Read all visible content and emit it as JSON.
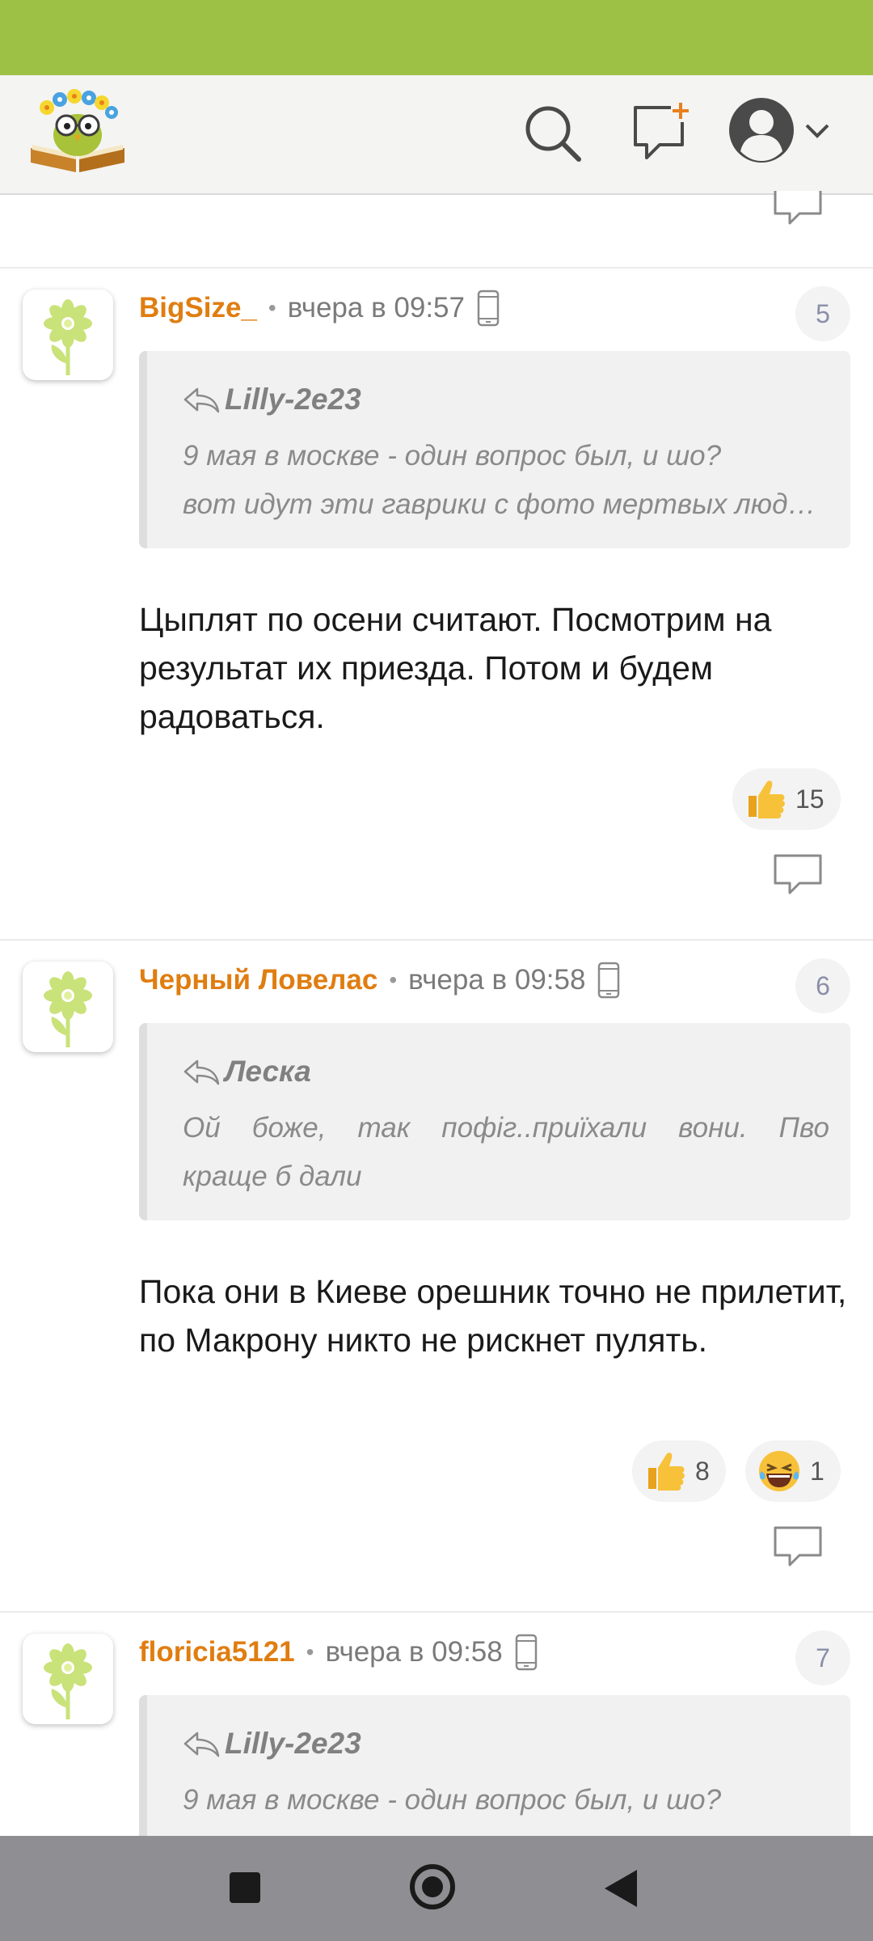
{
  "colors": {
    "status_bar": "#9cc145",
    "author": "#e07d10",
    "nav_bar": "#8f8f93"
  },
  "header": {
    "logo": "owl-book-logo",
    "icons": [
      "search-icon",
      "new-message-icon",
      "profile-icon",
      "chevron-down-icon"
    ]
  },
  "comments": [
    {
      "author": "BigSize_",
      "time": "вчера в 09:57",
      "number": "5",
      "quote_author": "Lilly-2e23",
      "quote_lines": [
        "9 мая в москве - один вопрос был, и шо?",
        "вот идут эти гаврики с фото мертвых люде…"
      ],
      "text": "Цыплят по осени считают. Посмотрим на результат их приезда. Потом и будем радоваться.",
      "reactions": [
        {
          "icon": "thumbs-up-icon",
          "count": "15"
        }
      ]
    },
    {
      "author": "Черный Ловелас",
      "time": "вчера в 09:58",
      "number": "6",
      "quote_author": "Леска",
      "quote_lines": [
        "Ой боже, так пофіг..приїхали вони. Пво",
        "краще б дали"
      ],
      "text": "Пока они в Киеве орешник точно не прилетит, по Макрону никто не рискнет пулять.",
      "reactions": [
        {
          "icon": "thumbs-up-icon",
          "count": "8"
        },
        {
          "icon": "laughing-face-icon",
          "count": "1"
        }
      ]
    },
    {
      "author": "floricia5121",
      "time": "вчера в 09:58",
      "number": "7",
      "quote_author": "Lilly-2e23",
      "quote_lines": [
        "9 мая в москве - один вопрос был, и шо?"
      ]
    }
  ]
}
